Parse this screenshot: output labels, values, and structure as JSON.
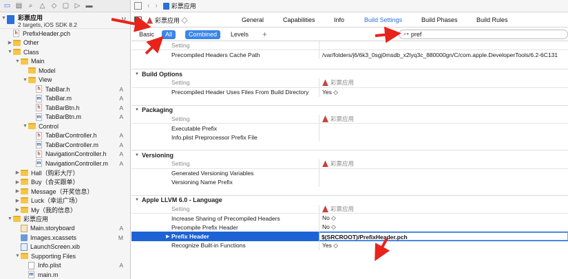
{
  "navigator": {
    "toolbar_icons": [
      "folder-icon",
      "source-control-icon",
      "search-icon",
      "warning-icon",
      "test-icon",
      "debug-icon",
      "breakpoint-icon",
      "report-icon"
    ],
    "project": {
      "name": "彩票应用",
      "subtitle": "2 targets, iOS SDK 8.2",
      "flag": "M"
    },
    "items": [
      {
        "label": "PrefixHeader.pch",
        "type": "h",
        "level": 0,
        "disc": "",
        "flag": ""
      },
      {
        "label": "Other",
        "type": "folder",
        "level": 0,
        "disc": "▶",
        "flag": ""
      },
      {
        "label": "Class",
        "type": "folder",
        "level": 0,
        "disc": "▼",
        "flag": ""
      },
      {
        "label": "Main",
        "type": "folder",
        "level": 1,
        "disc": "▼",
        "flag": ""
      },
      {
        "label": "Model",
        "type": "folder",
        "level": 2,
        "disc": "",
        "flag": ""
      },
      {
        "label": "View",
        "type": "folder",
        "level": 2,
        "disc": "▼",
        "flag": ""
      },
      {
        "label": "TabBar.h",
        "type": "h",
        "level": 3,
        "disc": "",
        "flag": "A"
      },
      {
        "label": "TabBar.m",
        "type": "m",
        "level": 3,
        "disc": "",
        "flag": "A"
      },
      {
        "label": "TabBarBtn.h",
        "type": "h",
        "level": 3,
        "disc": "",
        "flag": "A"
      },
      {
        "label": "TabBarBtn.m",
        "type": "m",
        "level": 3,
        "disc": "",
        "flag": "A"
      },
      {
        "label": "Control",
        "type": "folder",
        "level": 2,
        "disc": "▼",
        "flag": ""
      },
      {
        "label": "TabBarController.h",
        "type": "h",
        "level": 3,
        "disc": "",
        "flag": "A"
      },
      {
        "label": "TabBarController.m",
        "type": "m",
        "level": 3,
        "disc": "",
        "flag": "A"
      },
      {
        "label": "NavigationController.h",
        "type": "h",
        "level": 3,
        "disc": "",
        "flag": "A"
      },
      {
        "label": "NavigationController.m",
        "type": "m",
        "level": 3,
        "disc": "",
        "flag": "A"
      },
      {
        "label": "Hall（购彩大厅）",
        "type": "folder",
        "level": 1,
        "disc": "▶",
        "flag": ""
      },
      {
        "label": "Buy（合买跟单）",
        "type": "folder",
        "level": 1,
        "disc": "▶",
        "flag": ""
      },
      {
        "label": "Message（开奖信息）",
        "type": "folder",
        "level": 1,
        "disc": "▶",
        "flag": ""
      },
      {
        "label": "Luck（幸运广场）",
        "type": "folder",
        "level": 1,
        "disc": "▶",
        "flag": ""
      },
      {
        "label": "My（我的信息）",
        "type": "folder",
        "level": 1,
        "disc": "▶",
        "flag": ""
      },
      {
        "label": "彩票应用",
        "type": "folder",
        "level": 0,
        "disc": "▼",
        "flag": ""
      },
      {
        "label": "Main.storyboard",
        "type": "sb",
        "level": 1,
        "disc": "",
        "flag": "A"
      },
      {
        "label": "Images.xcassets",
        "type": "assets",
        "level": 1,
        "disc": "",
        "flag": "M"
      },
      {
        "label": "LaunchScreen.xib",
        "type": "xib",
        "level": 1,
        "disc": "",
        "flag": ""
      },
      {
        "label": "Supporting Files",
        "type": "folder",
        "level": 1,
        "disc": "▼",
        "flag": ""
      },
      {
        "label": "Info.plist",
        "type": "plist",
        "level": 2,
        "disc": "",
        "flag": "A"
      },
      {
        "label": "main.m",
        "type": "m",
        "level": 2,
        "disc": "",
        "flag": ""
      }
    ]
  },
  "jumpbar": {
    "project": "彩票应用"
  },
  "tabs": {
    "target_selector": "彩票应用 ◇",
    "items": [
      "General",
      "Capabilities",
      "Info",
      "Build Settings",
      "Build Phases",
      "Build Rules"
    ],
    "active": "Build Settings"
  },
  "filter": {
    "basic": "Basic",
    "all": "All",
    "combined": "Combined",
    "levels": "Levels",
    "plus": "+",
    "search_value": "pref"
  },
  "settings": {
    "top_partial": {
      "col_setting": "Setting",
      "rows": [
        {
          "name": "Precompiled Headers Cache Path",
          "value": "/var/folders/j6/6k3_0sgj0msdb_x2lyq3c_880000gn/C/com.apple.DeveloperTools/6.2-6C131"
        }
      ]
    },
    "sections": [
      {
        "title": "Build Options",
        "col_setting": "Setting",
        "col_target": "彩票应用",
        "rows": [
          {
            "name": "Precompiled Header Uses Files From Build Directory",
            "value": "Yes ◇"
          }
        ]
      },
      {
        "title": "Packaging",
        "col_setting": "Setting",
        "col_target": "彩票应用",
        "rows": [
          {
            "name": "Executable Prefix",
            "value": ""
          },
          {
            "name": "Info.plist Preprocessor Prefix File",
            "value": ""
          }
        ]
      },
      {
        "title": "Versioning",
        "col_setting": "Setting",
        "col_target": "彩票应用",
        "rows": [
          {
            "name": "Generated Versioning Variables",
            "value": ""
          },
          {
            "name": "Versioning Name Prefix",
            "value": ""
          }
        ]
      },
      {
        "title": "Apple LLVM 6.0 - Language",
        "col_setting": "Setting",
        "col_target": "彩票应用",
        "rows": [
          {
            "name": "Increase Sharing of Precompiled Headers",
            "value": "No ◇"
          },
          {
            "name": "Precompile Prefix Header",
            "value": "No ◇"
          },
          {
            "name": "Prefix Header",
            "value": "$(SRCROOT)/PrefixHeader.pch",
            "selected": true
          },
          {
            "name": "Recognize Built-in Functions",
            "value": "Yes ◇"
          }
        ]
      }
    ]
  },
  "colors": {
    "accent": "#3a86e8",
    "selection": "#1e63d6",
    "annotation": "#e8231b"
  }
}
